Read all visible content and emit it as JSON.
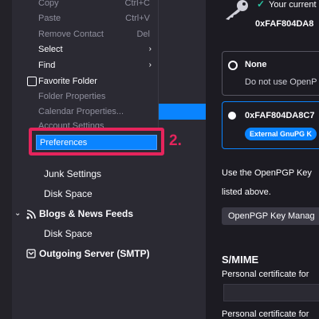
{
  "menu": {
    "items": [
      {
        "label": "Copy",
        "shortcut": "Ctrl+C",
        "disabled": true
      },
      {
        "label": "Paste",
        "shortcut": "Ctrl+V",
        "disabled": true
      },
      {
        "label": "Remove Contact",
        "shortcut": "Del",
        "disabled": true
      },
      {
        "label": "Select",
        "submenu": true
      },
      {
        "label": "Find",
        "submenu": true
      },
      {
        "label": "Favorite Folder",
        "checkbox": true
      },
      {
        "label": "Folder Properties",
        "disabled": true
      },
      {
        "label": "Calendar Properties...",
        "disabled": true
      },
      {
        "label": "Account Settings",
        "disabled": true
      },
      {
        "label": "Preferences"
      }
    ]
  },
  "annotation": {
    "step": "2."
  },
  "folder_tree": {
    "items": [
      {
        "label": "Junk Settings"
      },
      {
        "label": "Disk Space"
      },
      {
        "label": "Blogs & News Feeds"
      },
      {
        "label": "Disk Space"
      },
      {
        "label": "Outgoing Server (SMTP)"
      }
    ]
  },
  "right_panel": {
    "current_key_line": "Your current",
    "current_key_id": "0xFAF804DA8",
    "option_none_title": "None",
    "option_none_desc": "Do not use OpenP",
    "option_key_title": "0xFAF804DA8C7",
    "option_key_badge": "External GnuPG K",
    "use_key_line1": "Use the OpenPGP Key",
    "use_key_line2": "listed above.",
    "manager_button": "OpenPGP Key Manag",
    "smime_heading": "S/MIME",
    "personal_cert_1": "Personal certificate for",
    "personal_cert_2": "Personal certificate for"
  },
  "colors": {
    "accent": "#0a84ff",
    "annotation": "#e5245c",
    "check": "#2ac3a2"
  }
}
